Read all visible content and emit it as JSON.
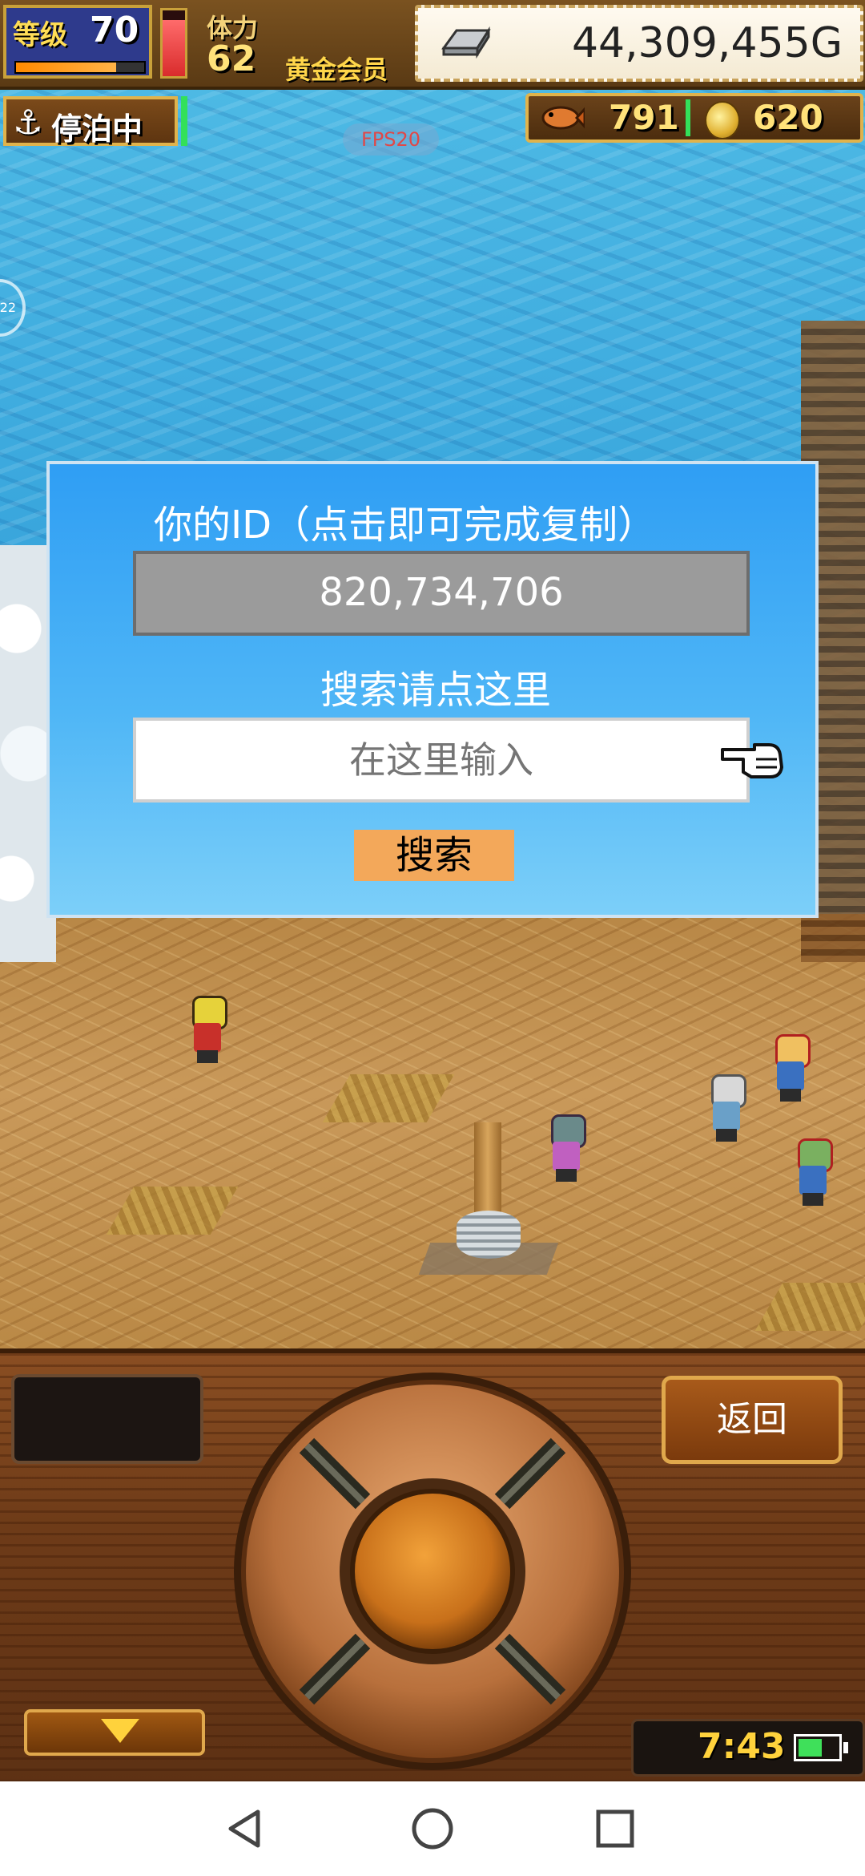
{
  "hud": {
    "level_label": "等级",
    "level_value": "70",
    "level_progress": 0.78,
    "stamina_label": "体力",
    "stamina_value": "62",
    "stamina_level": 0.85,
    "member_label": "黄金会员",
    "gold_value": "44,309,455G",
    "status_text": "停泊中",
    "fps_label": "FPS20",
    "food_value": "791",
    "coin_value": "620",
    "side_handle_label": "22"
  },
  "dialog": {
    "id_title": "你的ID（点击即可完成复制）",
    "id_value": "820,734,706",
    "search_title": "搜索请点这里",
    "search_placeholder": "在这里输入",
    "search_button": "搜索"
  },
  "controls": {
    "back_button": "返回",
    "clock": "7:43",
    "battery_level": 0.6
  },
  "icons": {
    "level": "level-badge",
    "gold": "gold-bar-icon",
    "anchor": "anchor-icon",
    "food": "fish-icon",
    "coin": "coin-icon",
    "pointer": "pointing-hand-icon",
    "expand": "triangle-down-icon",
    "battery": "battery-icon",
    "nav_back": "back-triangle-icon",
    "nav_home": "home-circle-icon",
    "nav_recents": "recents-square-icon"
  },
  "colors": {
    "dialog_top": "#2f9ef4",
    "dialog_bottom": "#7ccff9",
    "id_box": "#9b9b9b",
    "search_button": "#f3a85a",
    "hud_text_gold": "#ffe27a"
  }
}
